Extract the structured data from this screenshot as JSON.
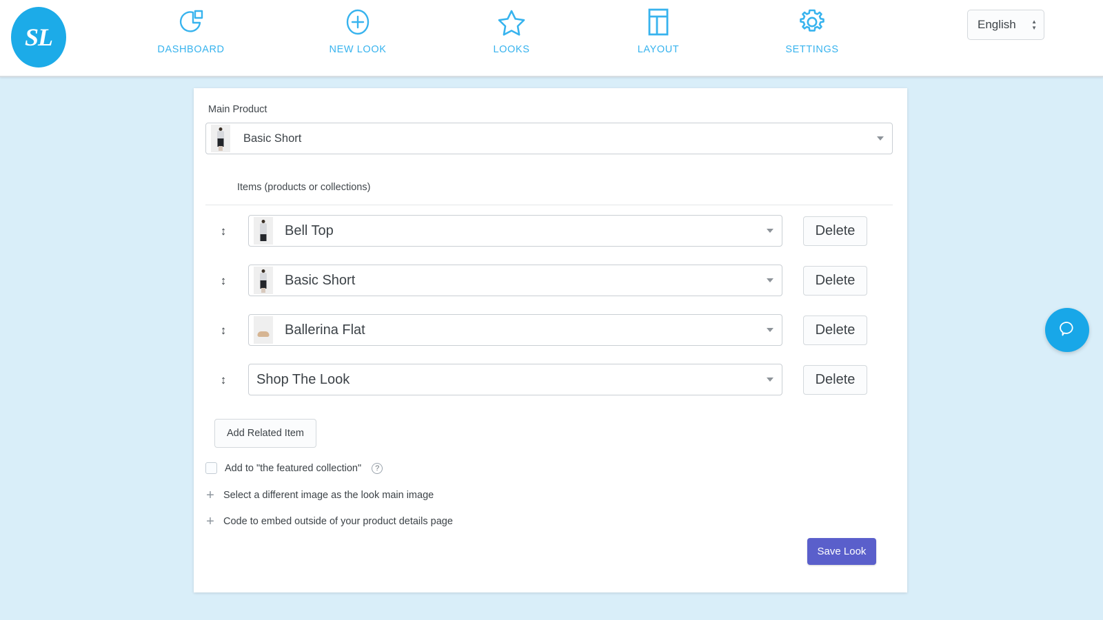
{
  "header": {
    "logo_text": "SL",
    "nav": [
      {
        "label": "DASHBOARD",
        "icon": "pie-chart-icon"
      },
      {
        "label": "NEW LOOK",
        "icon": "plus-circle-icon"
      },
      {
        "label": "LOOKS",
        "icon": "star-icon"
      },
      {
        "label": "LAYOUT",
        "icon": "layout-icon"
      },
      {
        "label": "SETTINGS",
        "icon": "gear-icon"
      }
    ],
    "language": {
      "value": "English",
      "icon": "up-down-arrows-icon"
    }
  },
  "main": {
    "main_product_label": "Main Product",
    "main_product_value": "Basic Short",
    "items_label": "Items (products or collections)",
    "items": [
      {
        "value": "Bell Top",
        "delete_label": "Delete",
        "has_thumb": true,
        "thumb": "woman-bell-top-photo"
      },
      {
        "value": "Basic Short",
        "delete_label": "Delete",
        "has_thumb": true,
        "thumb": "woman-basic-short-photo"
      },
      {
        "value": "Ballerina Flat",
        "delete_label": "Delete",
        "has_thumb": true,
        "thumb": "ballerina-flat-shoe-photo"
      },
      {
        "value": "Shop The Look",
        "delete_label": "Delete",
        "has_thumb": false,
        "thumb": ""
      }
    ],
    "add_related_item_label": "Add Related Item",
    "featured_checkbox_label": "Add to \"the featured collection\"",
    "featured_checkbox_checked": false,
    "help_icon_glyph": "?",
    "expand_rows": [
      {
        "label": "Select a different image as the look main image",
        "icon": "plus-icon"
      },
      {
        "label": "Code to embed outside of your product details page",
        "icon": "plus-icon"
      }
    ],
    "save_label": "Save Look"
  },
  "chat": {
    "icon": "chat-bubble-icon"
  },
  "colors": {
    "page_background": "#d9eef9",
    "brand_blue": "#37b3ee",
    "logo_blue": "#1cabe8",
    "save_button": "#5a5fcb",
    "chat_blue": "#18a7e8",
    "card_background": "#ffffff",
    "text": "#3c4247"
  }
}
